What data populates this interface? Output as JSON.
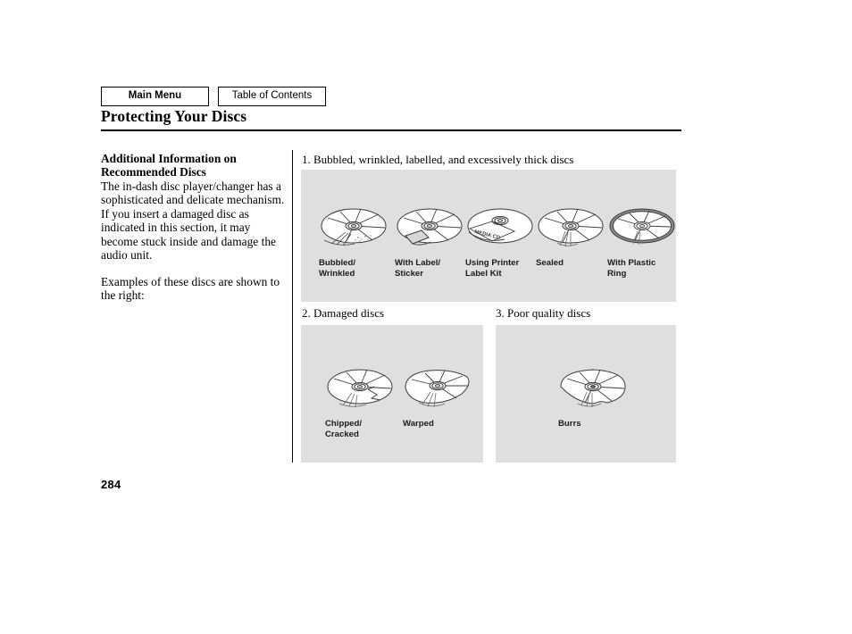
{
  "nav": {
    "main_menu": "Main Menu",
    "table_of_contents": "Table of Contents"
  },
  "header": {
    "title": "Protecting Your Discs"
  },
  "left_column": {
    "heading": "Additional Information on Recommended Discs",
    "body": "The in-dash disc player/changer has a sophisticated and delicate mechanism. If you insert a damaged disc as indicated in this section, it may become stuck inside and damage the audio unit.",
    "note": "Examples of these discs are shown to the right:"
  },
  "sections": [
    {
      "heading": "1. Bubbled, wrinkled, labelled, and excessively thick discs",
      "figures": [
        {
          "label": "Bubbled/\nWrinkled",
          "art": "disc-bubbled"
        },
        {
          "label": "With Label/\nSticker",
          "art": "disc-label-sticker"
        },
        {
          "label": "Using Printer\nLabel Kit",
          "art": "disc-printer-label"
        },
        {
          "label": "Sealed",
          "art": "disc-sealed"
        },
        {
          "label": "With Plastic\nRing",
          "art": "disc-plastic-ring"
        }
      ]
    },
    {
      "heading": "2. Damaged discs",
      "figures": [
        {
          "label": "Chipped/\nCracked",
          "art": "disc-chipped-cracked"
        },
        {
          "label": "Warped",
          "art": "disc-warped"
        }
      ]
    },
    {
      "heading": "3. Poor quality discs",
      "figures": [
        {
          "label": "Burrs",
          "art": "disc-burrs"
        }
      ]
    }
  ],
  "footer": {
    "page_number": "284"
  },
  "colors": {
    "panel_background": "#dfdfdf",
    "text": "#000000",
    "disc_outline": "#3c3c3c",
    "page_background": "#ffffff"
  }
}
